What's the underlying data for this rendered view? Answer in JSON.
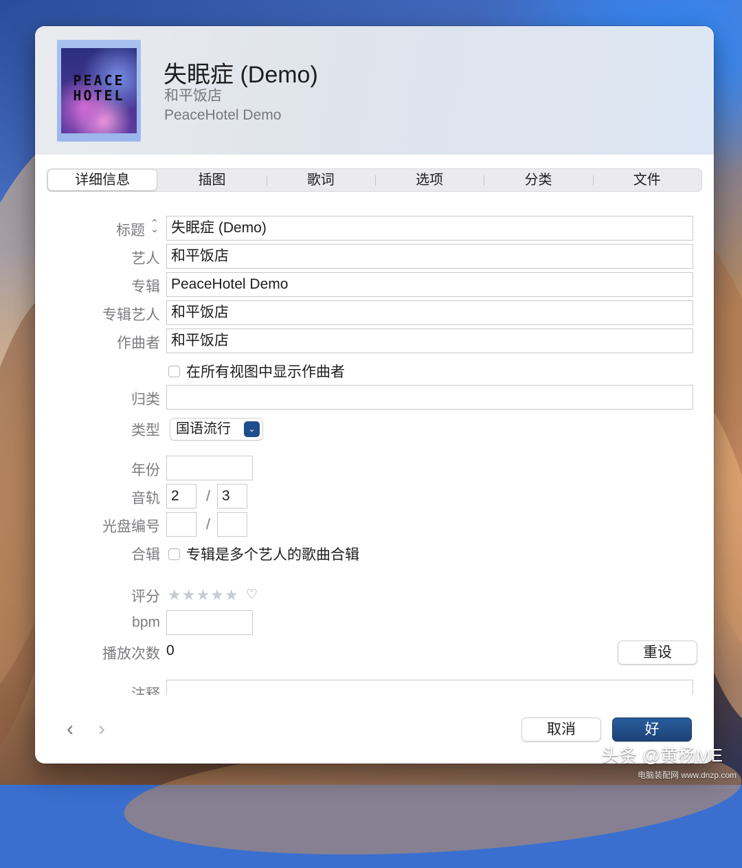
{
  "header": {
    "title": "失眠症 (Demo)",
    "artist": "和平饭店",
    "album": "PeaceHotel Demo",
    "artwork_text": "PEACE HOTEL"
  },
  "tabs": [
    {
      "label": "详细信息",
      "active": true
    },
    {
      "label": "插图",
      "active": false
    },
    {
      "label": "歌词",
      "active": false
    },
    {
      "label": "选项",
      "active": false
    },
    {
      "label": "分类",
      "active": false
    },
    {
      "label": "文件",
      "active": false
    }
  ],
  "details": {
    "title_label": "标题",
    "title_value": "失眠症 (Demo)",
    "artist_label": "艺人",
    "artist_value": "和平饭店",
    "album_label": "专辑",
    "album_value": "PeaceHotel Demo",
    "album_artist_label": "专辑艺人",
    "album_artist_value": "和平饭店",
    "composer_label": "作曲者",
    "composer_value": "和平饭店",
    "show_composer_label": "在所有视图中显示作曲者",
    "show_composer_checked": false,
    "grouping_label": "归类",
    "grouping_value": "",
    "genre_label": "类型",
    "genre_value": "国语流行",
    "year_label": "年份",
    "year_value": "",
    "track_label": "音轨",
    "track_number": "2",
    "track_total": "3",
    "slash": "/",
    "disc_label": "光盘编号",
    "disc_number": "",
    "disc_total": "",
    "compilation_label": "合辑",
    "compilation_text": "专辑是多个艺人的歌曲合辑",
    "compilation_checked": false,
    "rating_label": "评分",
    "rating_stars": "★★★★★",
    "rating_value": 0,
    "heart": "♡",
    "bpm_label": "bpm",
    "bpm_value": "",
    "plays_label": "播放次数",
    "plays_value": "0",
    "reset_label": "重设",
    "notes_label": "注释"
  },
  "footer": {
    "prev_icon": "‹",
    "next_icon": "›",
    "cancel_label": "取消",
    "ok_label": "好"
  },
  "watermark": {
    "main": "头条 @黄杨ME",
    "small": "电脑装配网 www.dnzp.com"
  },
  "colors": {
    "accent": "#1f4e8c",
    "label": "#7c7c80"
  }
}
